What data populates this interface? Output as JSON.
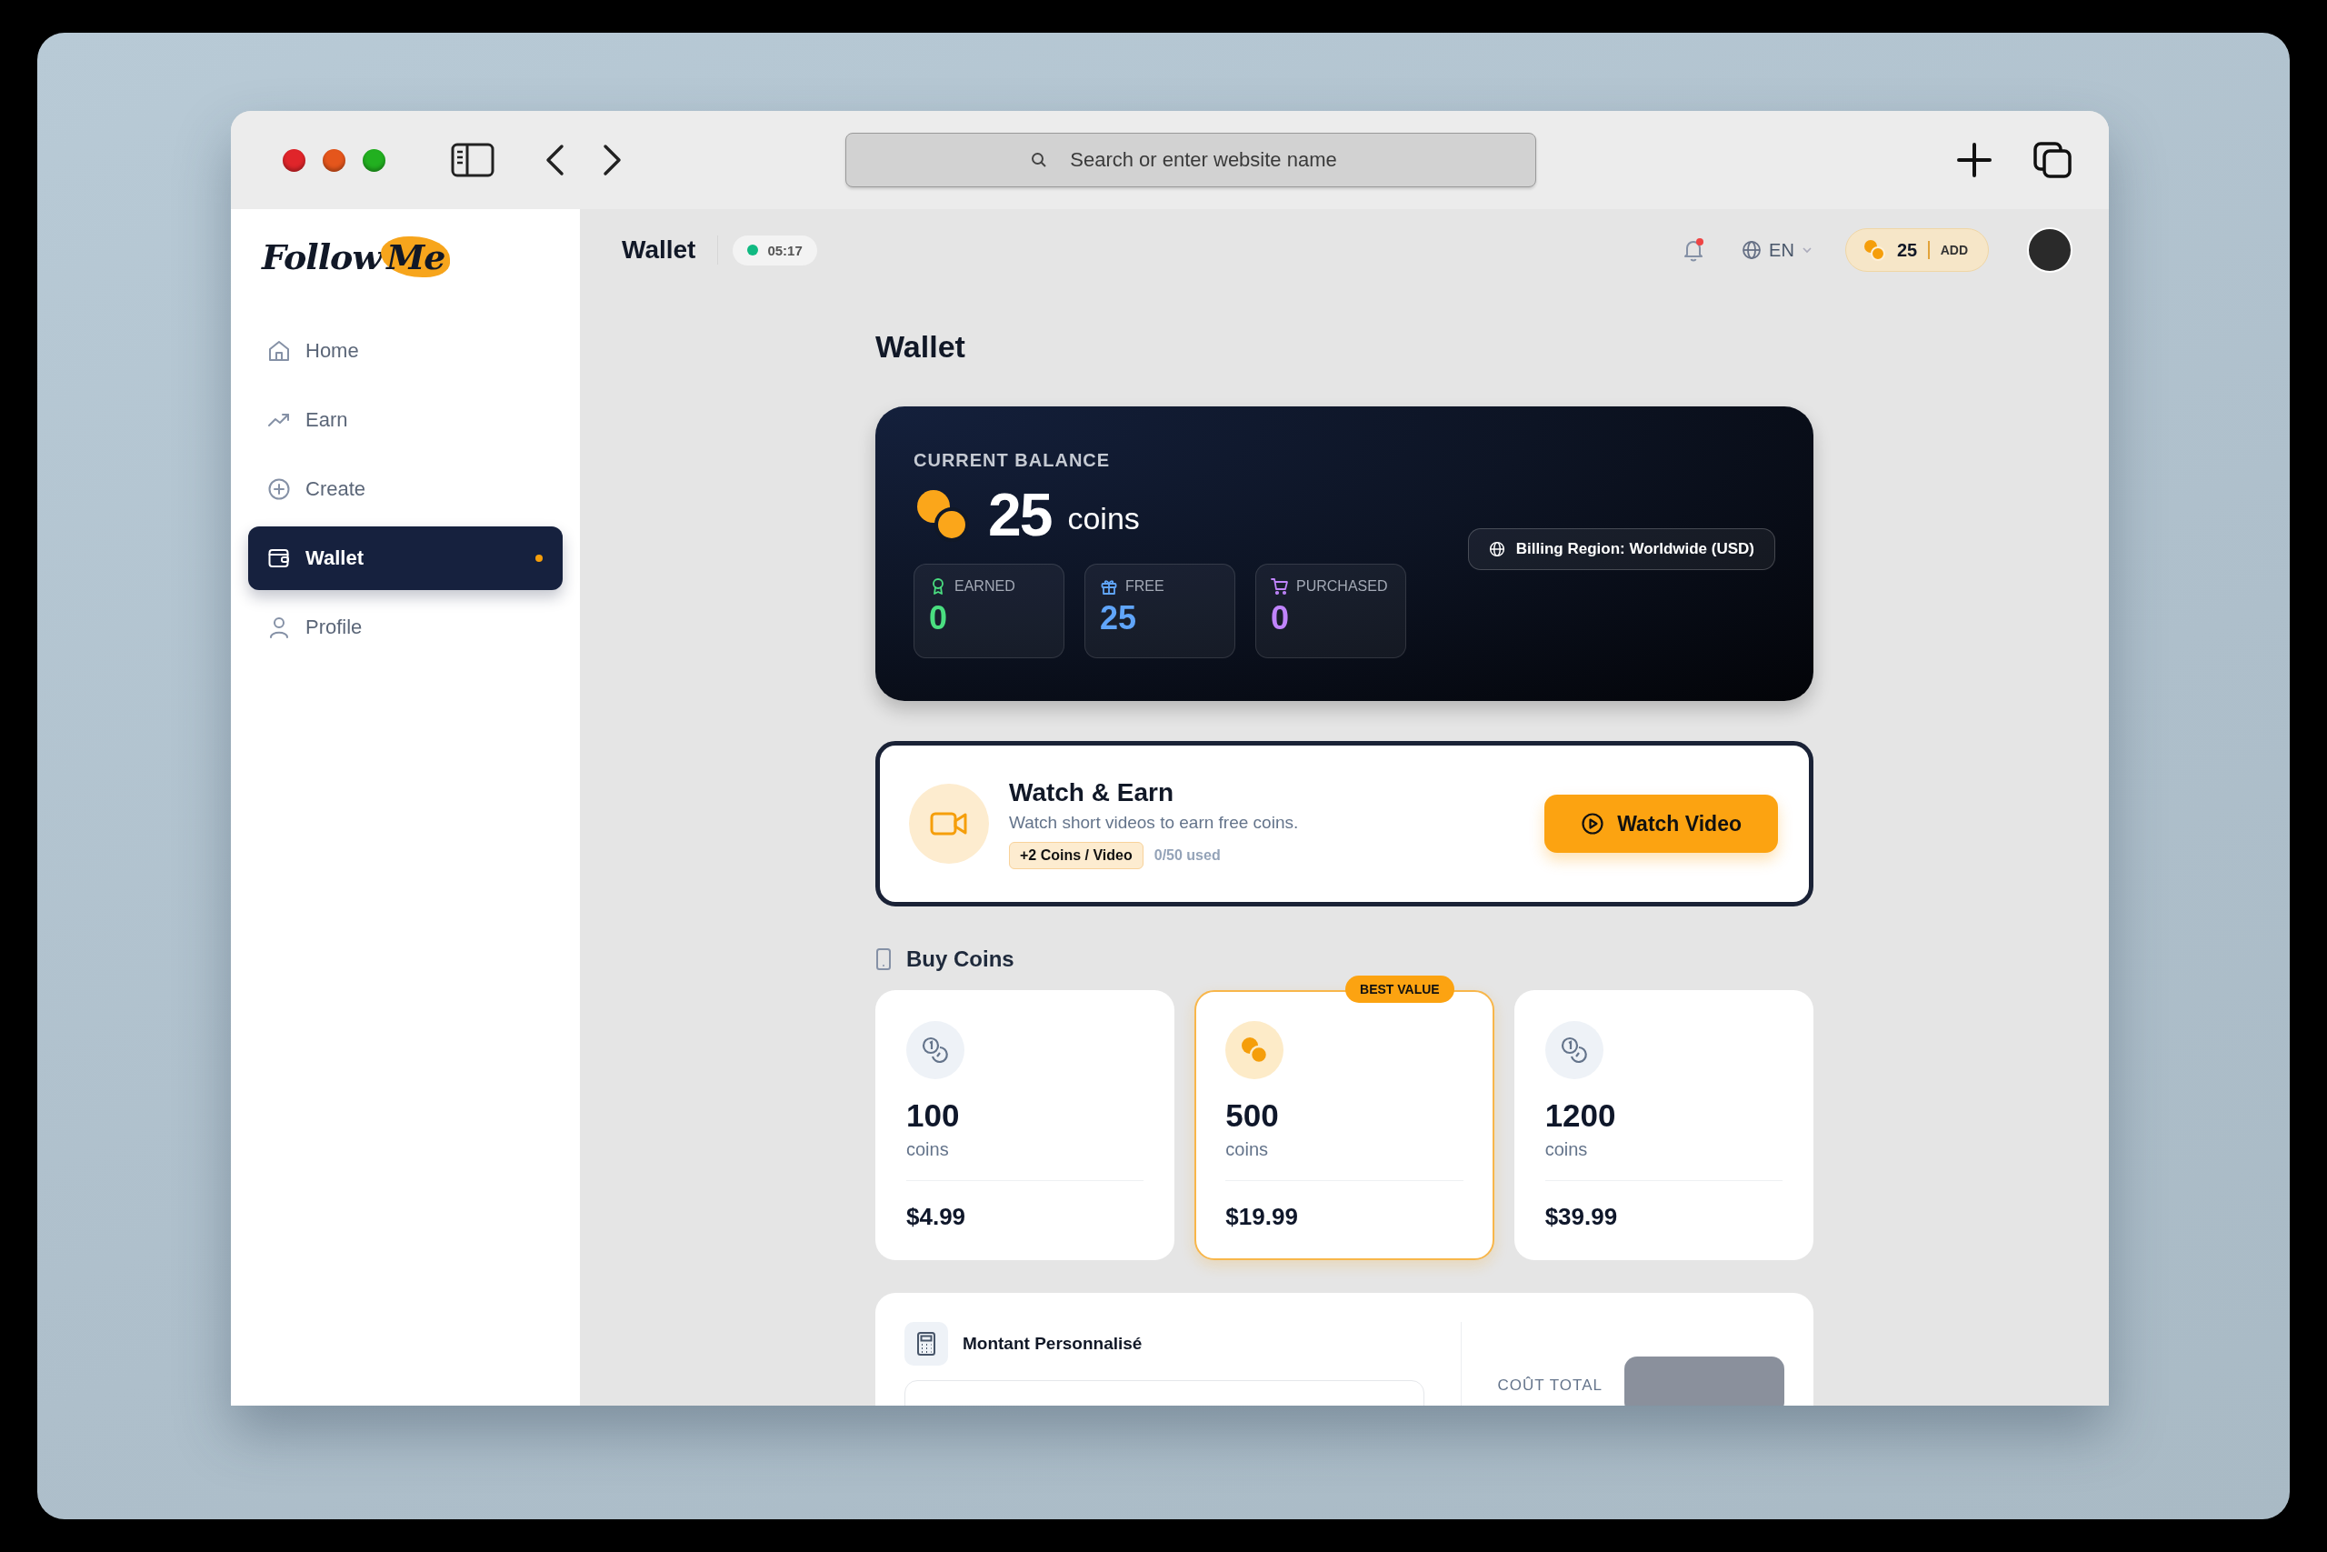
{
  "browser": {
    "address_placeholder": "Search or enter website name"
  },
  "sidebar": {
    "logo": {
      "first": "Follow",
      "second": "Me"
    },
    "items": [
      {
        "label": "Home",
        "selected": false
      },
      {
        "label": "Earn",
        "selected": false
      },
      {
        "label": "Create",
        "selected": false
      },
      {
        "label": "Wallet",
        "selected": true
      },
      {
        "label": "Profile",
        "selected": false
      }
    ]
  },
  "header": {
    "title": "Wallet",
    "timer": "05:17",
    "notification_dot": true,
    "language": "EN",
    "coins": "25",
    "add_label": "ADD"
  },
  "page_title": "Wallet",
  "balance": {
    "label": "CURRENT BALANCE",
    "amount": "25",
    "unit": "coins",
    "billing_region": "Billing Region: Worldwide (USD)",
    "stats": [
      {
        "kind": "earned",
        "label": "EARNED",
        "value": "0",
        "color": "#4ade80"
      },
      {
        "kind": "free",
        "label": "FREE",
        "value": "25",
        "color": "#60a5fa"
      },
      {
        "kind": "purchased",
        "label": "PURCHASED",
        "value": "0",
        "color": "#c084fc"
      }
    ]
  },
  "watch_earn": {
    "title": "Watch & Earn",
    "description": "Watch short videos to earn free coins.",
    "reward": "+2 Coins / Video",
    "usage": "0/50 used",
    "button": "Watch Video"
  },
  "buy_coins": {
    "title": "Buy Coins",
    "packs": [
      {
        "amount": "100",
        "unit": "coins",
        "price": "$4.99",
        "featured": false
      },
      {
        "amount": "500",
        "unit": "coins",
        "price": "$19.99",
        "featured": true,
        "badge": "BEST VALUE"
      },
      {
        "amount": "1200",
        "unit": "coins",
        "price": "$39.99",
        "featured": false
      }
    ]
  },
  "custom_amount": {
    "title": "Montant Personnalisé",
    "total_label": "COÛT TOTAL"
  }
}
